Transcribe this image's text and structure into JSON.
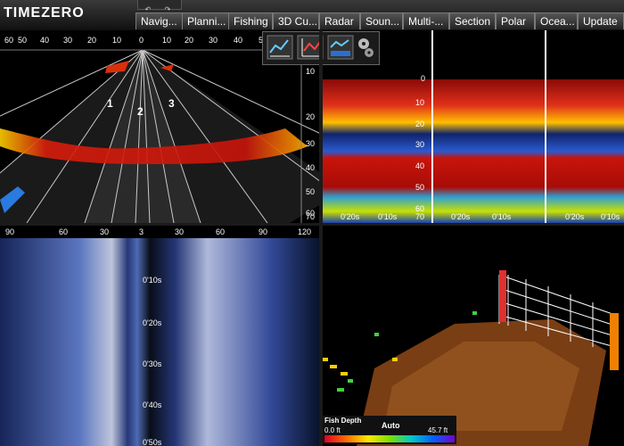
{
  "app": {
    "logo": "TIMEZERO"
  },
  "undo_bar": {
    "undo_glyph": "↶",
    "redo_glyph": "↷"
  },
  "tabs": [
    {
      "label": "Navig..."
    },
    {
      "label": "Planni..."
    },
    {
      "label": "Fishing"
    },
    {
      "label": "3D Cu..."
    },
    {
      "label": "Radar"
    },
    {
      "label": "Soun..."
    },
    {
      "label": "Multi-..."
    },
    {
      "label": "Section"
    },
    {
      "label": "Polar"
    },
    {
      "label": "Ocea..."
    },
    {
      "label": "Update"
    }
  ],
  "sector_view": {
    "top_scale": [
      "60",
      "50",
      "40",
      "30",
      "20",
      "10",
      "0",
      "10",
      "20",
      "30",
      "40",
      "50"
    ],
    "depth_scale": [
      "10",
      "20",
      "30",
      "40",
      "50",
      "60",
      "70"
    ],
    "beam_labels": [
      "1",
      "2",
      "3"
    ]
  },
  "echo_columns": {
    "depth_scale": [
      "0",
      "10",
      "20",
      "30",
      "40",
      "50",
      "60",
      "70"
    ],
    "time_labels": [
      "0'20s",
      "0'10s"
    ],
    "tools": [
      "sounder-trend-icon",
      "sector-scan-icon",
      "single-beam-icon",
      "settings-gears-icon"
    ]
  },
  "side_scan": {
    "top_scale": [
      "90",
      "60",
      "30",
      "3",
      "30",
      "60",
      "90",
      "120"
    ],
    "time_labels": [
      "0'10s",
      "0'20s",
      "0'30s",
      "0'40s",
      "0'50s"
    ]
  },
  "fish_depth_legend": {
    "title": "Fish Depth",
    "mode": "Auto",
    "min_value": "0.0 ft",
    "max_value": "45.7 ft"
  },
  "colors": {
    "accent": "#f7d000",
    "echo_strong": "#c8140a",
    "side_scan_blue": "#4a6fd0",
    "seabed_3d": "#8a4a1c"
  }
}
